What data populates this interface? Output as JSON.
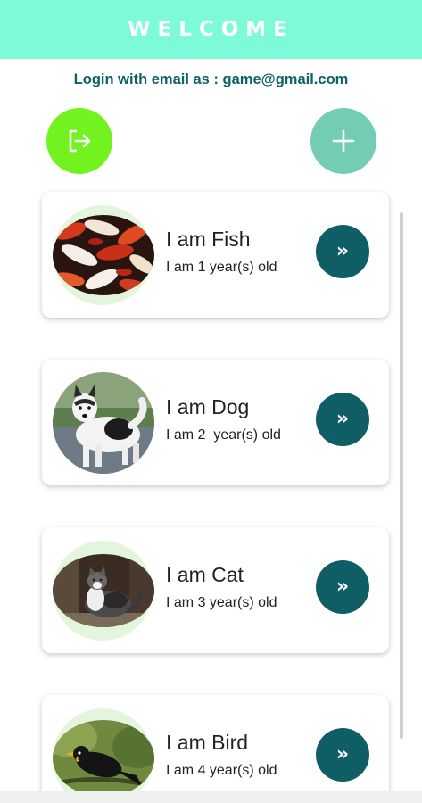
{
  "header": {
    "title": "WELCOME"
  },
  "login_info": "Login with email as : game@gmail.com",
  "actions": {
    "logout_icon": "logout-icon",
    "add_icon": "plus-icon"
  },
  "pets": [
    {
      "name": "I am Fish",
      "age": "I am 1 year(s) old",
      "go_label": "»"
    },
    {
      "name": "I am Dog",
      "age": "I am 2  year(s) old",
      "go_label": "»"
    },
    {
      "name": "I am Cat",
      "age": "I am 3 year(s) old",
      "go_label": "»"
    },
    {
      "name": "I am Bird",
      "age": "I am 4 year(s) old",
      "go_label": "»"
    }
  ],
  "colors": {
    "header": "#7dfad7",
    "accent": "#0f5e66",
    "logout": "#72f31f",
    "add": "#73cdb5"
  }
}
